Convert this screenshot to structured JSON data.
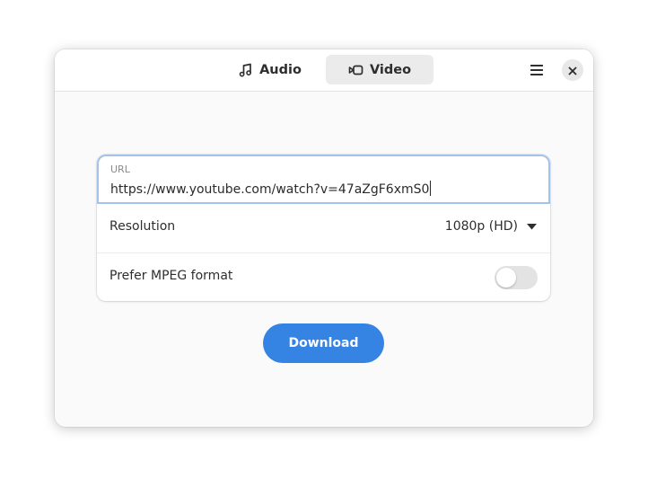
{
  "header": {
    "tabs": [
      {
        "label": "Audio",
        "icon": "music-note-icon",
        "active": false
      },
      {
        "label": "Video",
        "icon": "video-camera-icon",
        "active": true
      }
    ],
    "menu_icon": "hamburger-menu-icon",
    "close_icon": "close-icon"
  },
  "form": {
    "url_label": "URL",
    "url_value": "https://www.youtube.com/watch?v=47aZgF6xmS0",
    "resolution_label": "Resolution",
    "resolution_value": "1080p (HD)",
    "mpeg_label": "Prefer MPEG format",
    "mpeg_enabled": false
  },
  "download_label": "Download",
  "colors": {
    "accent": "#3584e4",
    "focus_border": "#a4c3ec",
    "window_bg": "#fafafa"
  }
}
